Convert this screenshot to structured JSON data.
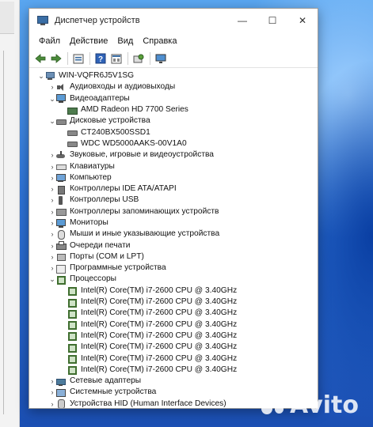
{
  "window": {
    "title": "Диспетчер устройств",
    "controls": {
      "minimize": "—",
      "maximize": "☐",
      "close": "✕"
    }
  },
  "menu": [
    "Файл",
    "Действие",
    "Вид",
    "Справка"
  ],
  "toolbar": {
    "icons": [
      "back-arrow-icon",
      "forward-arrow-icon",
      "properties-icon",
      "help-icon",
      "view-icon",
      "scan-hardware-icon",
      "monitor-icon"
    ]
  },
  "tree": {
    "root": "WIN-VQFR6J5V1SG",
    "categories": [
      {
        "label": "Аудиовходы и аудиовыходы",
        "icon": "speaker-icon",
        "expanded": false
      },
      {
        "label": "Видеоадаптеры",
        "icon": "display-adapter-icon",
        "expanded": true,
        "children": [
          "AMD Radeon HD 7700 Series"
        ]
      },
      {
        "label": "Дисковые устройства",
        "icon": "disk-drive-icon",
        "expanded": true,
        "children": [
          "CT240BX500SSD1",
          "WDC WD5000AAKS-00V1A0"
        ]
      },
      {
        "label": "Звуковые, игровые и видеоустройства",
        "icon": "gamepad-icon",
        "expanded": false
      },
      {
        "label": "Клавиатуры",
        "icon": "keyboard-icon",
        "expanded": false
      },
      {
        "label": "Компьютер",
        "icon": "computer-icon",
        "expanded": false
      },
      {
        "label": "Контроллеры IDE ATA/ATAPI",
        "icon": "ide-controller-icon",
        "expanded": false
      },
      {
        "label": "Контроллеры USB",
        "icon": "usb-icon",
        "expanded": false
      },
      {
        "label": "Контроллеры запоминающих устройств",
        "icon": "storage-controller-icon",
        "expanded": false
      },
      {
        "label": "Мониторы",
        "icon": "monitor-icon",
        "expanded": false
      },
      {
        "label": "Мыши и иные указывающие устройства",
        "icon": "mouse-icon",
        "expanded": false
      },
      {
        "label": "Очереди печати",
        "icon": "printer-icon",
        "expanded": false
      },
      {
        "label": "Порты (COM и LPT)",
        "icon": "port-icon",
        "expanded": false
      },
      {
        "label": "Программные устройства",
        "icon": "software-device-icon",
        "expanded": false
      },
      {
        "label": "Процессоры",
        "icon": "processor-icon",
        "expanded": true,
        "children": [
          "Intel(R) Core(TM) i7-2600 CPU @ 3.40GHz",
          "Intel(R) Core(TM) i7-2600 CPU @ 3.40GHz",
          "Intel(R) Core(TM) i7-2600 CPU @ 3.40GHz",
          "Intel(R) Core(TM) i7-2600 CPU @ 3.40GHz",
          "Intel(R) Core(TM) i7-2600 CPU @ 3.40GHz",
          "Intel(R) Core(TM) i7-2600 CPU @ 3.40GHz",
          "Intel(R) Core(TM) i7-2600 CPU @ 3.40GHz",
          "Intel(R) Core(TM) i7-2600 CPU @ 3.40GHz"
        ]
      },
      {
        "label": "Сетевые адаптеры",
        "icon": "network-adapter-icon",
        "expanded": false
      },
      {
        "label": "Системные устройства",
        "icon": "system-device-icon",
        "expanded": false
      },
      {
        "label": "Устройства HID (Human Interface Devices)",
        "icon": "hid-icon",
        "expanded": false
      }
    ]
  },
  "watermark": "Avito"
}
